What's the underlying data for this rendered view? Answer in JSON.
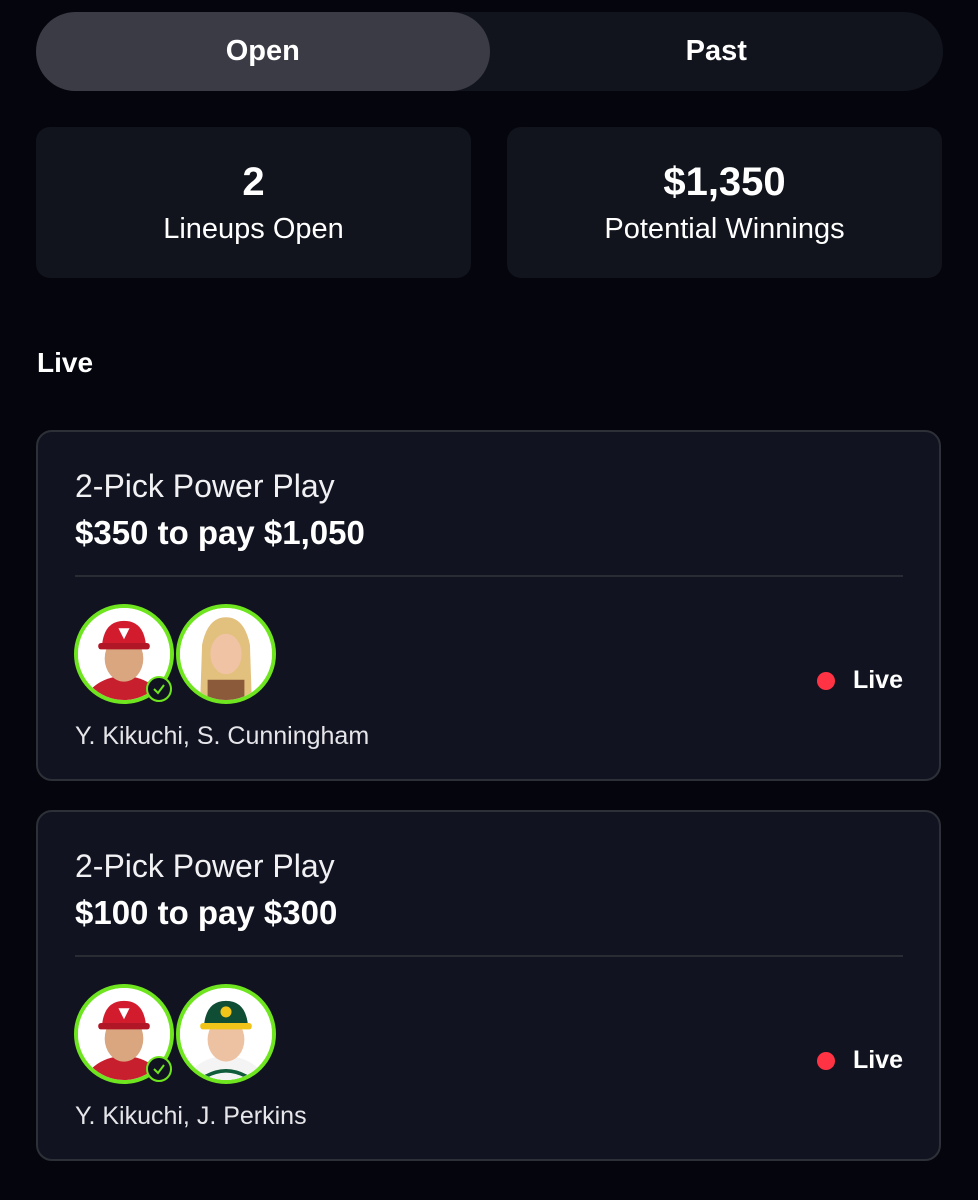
{
  "tabs": [
    {
      "label": "Open",
      "active": true
    },
    {
      "label": "Past",
      "active": false
    }
  ],
  "stats": {
    "lineups": {
      "value": "2",
      "label": "Lineups Open"
    },
    "winnings": {
      "value": "$1,350",
      "label": "Potential Winnings"
    }
  },
  "section": {
    "title": "Live"
  },
  "colors": {
    "accent": "#6ee51f",
    "live_dot": "#ff3344",
    "card_bg": "#111420",
    "page_bg": "#05060d"
  },
  "lineups": [
    {
      "title": "2-Pick Power Play",
      "subtitle": "$350 to pay $1,050",
      "players": [
        {
          "icon": "player-avatar-angels-cap",
          "checked": true
        },
        {
          "icon": "player-avatar-blonde",
          "checked": false
        }
      ],
      "names": "Y. Kikuchi, S. Cunningham",
      "status": "Live"
    },
    {
      "title": "2-Pick Power Play",
      "subtitle": "$100 to pay $300",
      "players": [
        {
          "icon": "player-avatar-angels-cap",
          "checked": true
        },
        {
          "icon": "player-avatar-athletics-cap",
          "checked": false
        }
      ],
      "names": "Y. Kikuchi, J. Perkins",
      "status": "Live"
    }
  ]
}
